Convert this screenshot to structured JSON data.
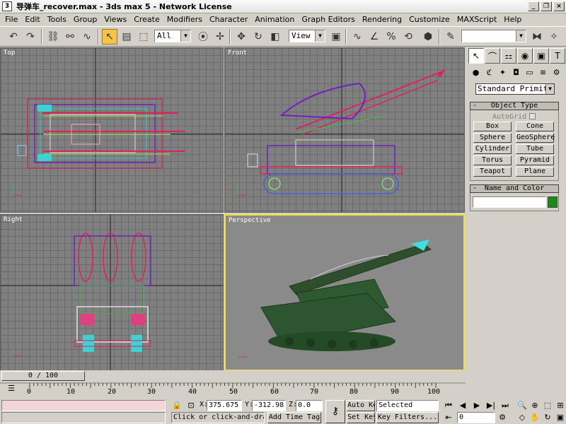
{
  "window": {
    "title": "导弹车_recover.max - 3ds max 5 - Network License",
    "icon": "3ds-max-icon"
  },
  "menu": [
    "File",
    "Edit",
    "Tools",
    "Group",
    "Views",
    "Create",
    "Modifiers",
    "Character",
    "Animation",
    "Graph Editors",
    "Rendering",
    "Customize",
    "MAXScript",
    "Help"
  ],
  "toolbar": {
    "selection_filter": "All",
    "reference_coord": "View",
    "named_selection": ""
  },
  "viewports": {
    "top": "Top",
    "front": "Front",
    "right": "Right",
    "perspective": "Perspective"
  },
  "command_panel": {
    "category": "Standard Primitiv",
    "object_type_header": "Object Type",
    "autogrid": "AutoGrid",
    "objects": [
      "Box",
      "Cone",
      "Sphere",
      "GeoSphere",
      "Cylinder",
      "Tube",
      "Torus",
      "Pyramid",
      "Teapot",
      "Plane"
    ],
    "name_color_header": "Name and Color",
    "name_value": "",
    "object_color": "#1a8a1a"
  },
  "timeline": {
    "position": "0 / 100",
    "ticks": [
      "0",
      "10",
      "20",
      "30",
      "40",
      "50",
      "60",
      "70",
      "80",
      "90",
      "100"
    ]
  },
  "status": {
    "x_label": "X:",
    "x_value": "375.675",
    "y_label": "Y:",
    "y_value": "-312.98:",
    "z_label": "Z:",
    "z_value": "0.0",
    "auto_key": "Auto Key",
    "set_key": "Set Key",
    "key_mode": "Selected",
    "key_filters": "Key Filters...",
    "prompt": "Click or click-and-drag",
    "add_time_tag": "Add Time Tag",
    "current_frame": "0"
  }
}
